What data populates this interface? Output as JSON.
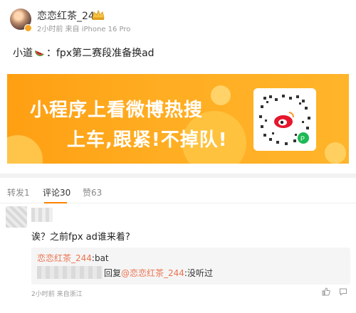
{
  "post": {
    "username": "恋恋红茶_244",
    "meta": "2小时前 来自 iPhone 16 Pro",
    "text_before": "小道",
    "text_after": "：fpx第二赛段准备换ad"
  },
  "banner": {
    "line1": "小程序上看微博热搜",
    "line2": "上车,跟紧!不掉队!"
  },
  "tabs": [
    {
      "label": "转发1"
    },
    {
      "label": "评论30"
    },
    {
      "label": "赞63"
    }
  ],
  "comment": {
    "text": "诶？之前fpx ad谁来着?",
    "reply1_user": "恋恋红茶_244",
    "reply1_text": ":bat",
    "reply2_prefix": "回复",
    "reply2_user": "@恋恋红茶_244",
    "reply2_text": ":没听过",
    "meta": "2小时前 来自浙江"
  },
  "colors": {
    "accent": "#ff8200",
    "link": "#eb7350",
    "banner": "#ffad22"
  }
}
